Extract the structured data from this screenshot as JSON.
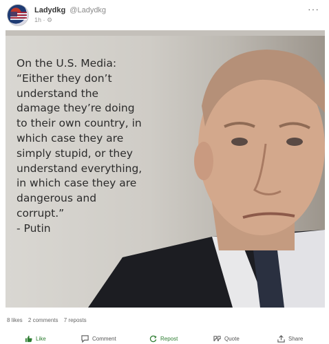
{
  "post": {
    "author_name": "Ladydkg",
    "author_handle": "@Ladydkg",
    "time": "1h",
    "quote_lines": [
      "On the U.S. Media:",
      "“Either they don’t",
      "understand the",
      "damage they’re doing",
      "to their own country, in",
      "which case they are",
      "simply stupid, or they",
      "understand everything,",
      "in which case they are",
      "dangerous and",
      "corrupt.”",
      "- Putin"
    ]
  },
  "stats": {
    "likes": "8 likes",
    "comments": "2 comments",
    "reposts": "7 reposts"
  },
  "actions": {
    "like": "Like",
    "comment": "Comment",
    "repost": "Repost",
    "quote": "Quote",
    "share": "Share"
  },
  "icons": {
    "more": "more-icon",
    "globe": "globe-icon",
    "like": "thumbs-up-icon",
    "comment": "comment-icon",
    "repost": "repost-icon",
    "quote": "quote-icon",
    "share": "share-icon"
  },
  "colors": {
    "accent_green": "#2e7d32"
  }
}
